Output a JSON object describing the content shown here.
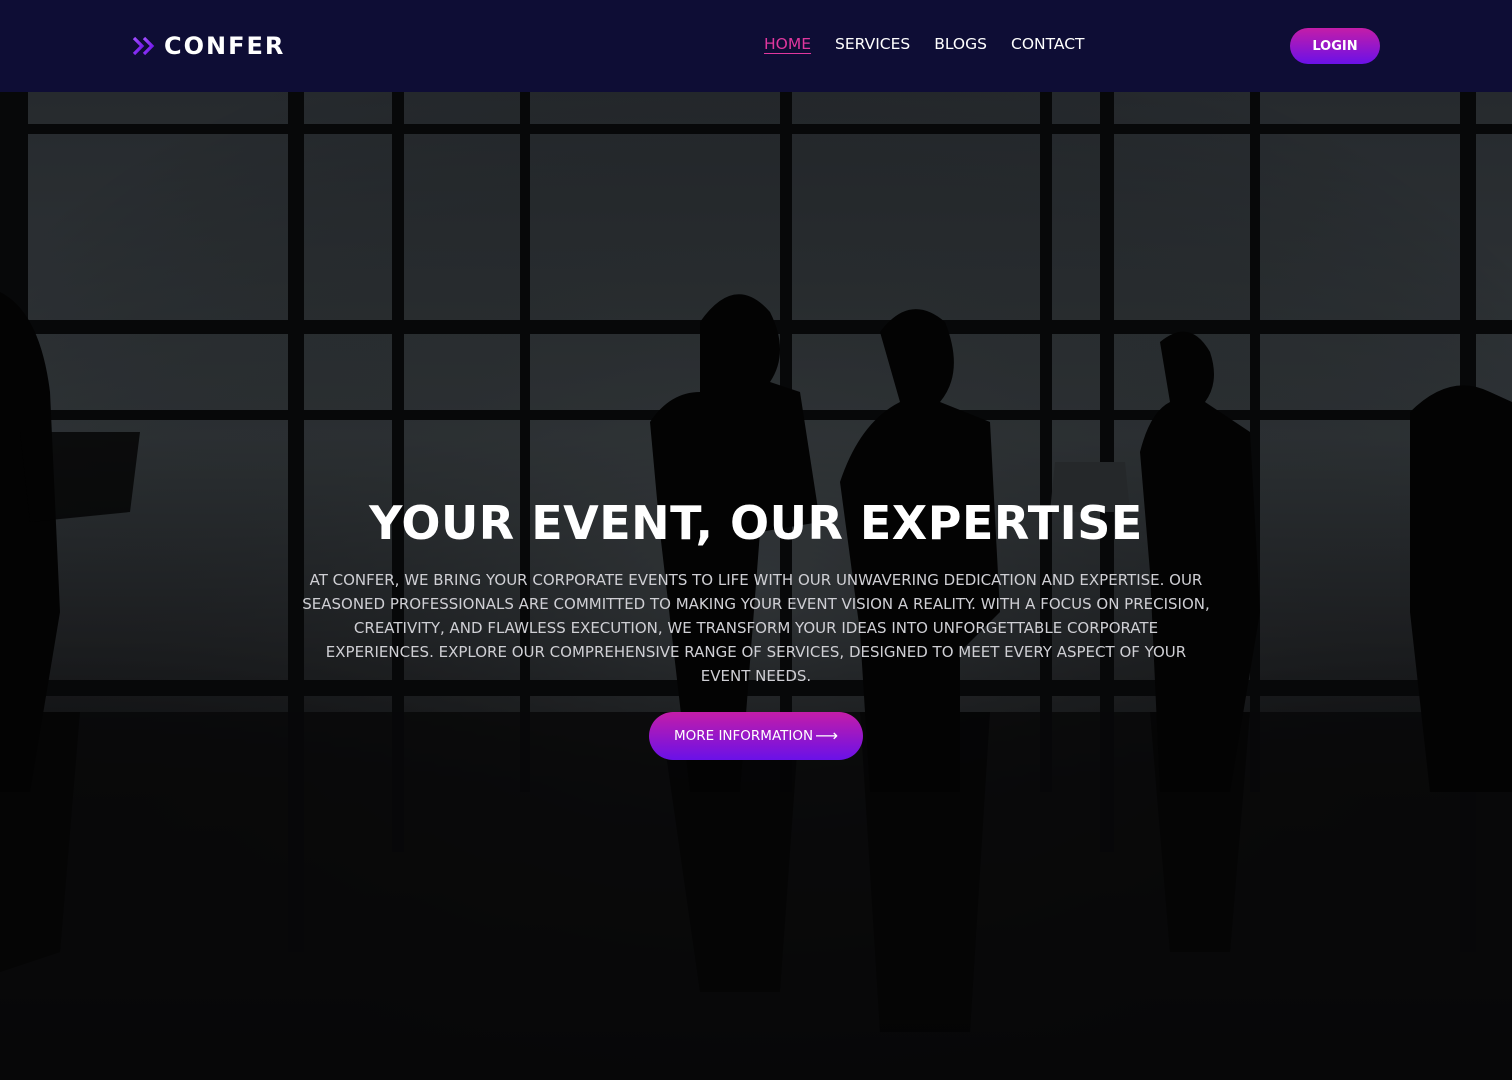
{
  "brand": {
    "name": "CONFER",
    "icon": "double-chevron-right-icon",
    "accent_color": "#8b3dff"
  },
  "nav": {
    "items": [
      {
        "label": "HOME",
        "active": true
      },
      {
        "label": "SERVICES",
        "active": false
      },
      {
        "label": "BLOGS",
        "active": false
      },
      {
        "label": "CONTACT",
        "active": false
      }
    ],
    "active_color": "#e0379e",
    "background": "#0e0d35"
  },
  "login": {
    "label": "LOGIN"
  },
  "hero": {
    "title": "YOUR EVENT, OUR EXPERTISE",
    "description": "AT CONFER, WE BRING YOUR CORPORATE EVENTS TO LIFE WITH OUR UNWAVERING DEDICATION AND EXPERTISE. OUR SEASONED PROFESSIONALS ARE COMMITTED TO MAKING YOUR EVENT VISION A REALITY. WITH A FOCUS ON PRECISION, CREATIVITY, AND FLAWLESS EXECUTION, WE TRANSFORM YOUR IDEAS INTO UNFORGETTABLE CORPORATE EXPERIENCES. EXPLORE OUR COMPREHENSIVE RANGE OF SERVICES, DESIGNED TO MEET EVERY ASPECT OF YOUR EVENT NEEDS.",
    "cta_label": "MORE INFORMATION",
    "cta_icon": "arrow-right-icon",
    "cta_arrow": "⟶",
    "background_image": "business-people-silhouettes-office"
  },
  "colors": {
    "button_gradient_top": "#c41da8",
    "button_gradient_bottom": "#6a11e8"
  }
}
